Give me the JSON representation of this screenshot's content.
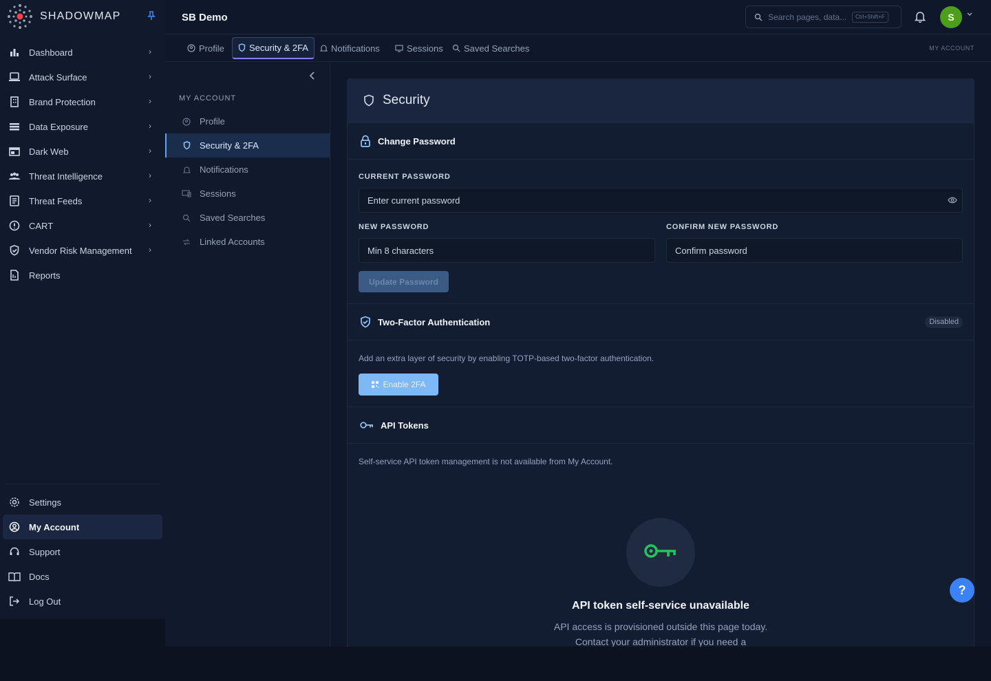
{
  "brand": {
    "name": "SHADOWMAP",
    "accent": "#3b82f6"
  },
  "header": {
    "org": "SB Demo",
    "search_placeholder": "Search pages, data...",
    "search_shortcut": "Ctrl+Shift+F",
    "avatar_initial": "S",
    "avatar_color": "#4d9e1a"
  },
  "sidebar": {
    "items": [
      {
        "label": "Dashboard",
        "icon": "bar-chart-icon"
      },
      {
        "label": "Attack Surface",
        "icon": "laptop-icon"
      },
      {
        "label": "Brand Protection",
        "icon": "building-icon"
      },
      {
        "label": "Data Exposure",
        "icon": "database-icon"
      },
      {
        "label": "Dark Web",
        "icon": "browser-icon"
      },
      {
        "label": "Threat Intelligence",
        "icon": "users-icon"
      },
      {
        "label": "Threat Feeds",
        "icon": "feed-icon"
      },
      {
        "label": "CART",
        "icon": "alert-circle-icon"
      },
      {
        "label": "Vendor Risk Management",
        "icon": "shield-check-icon"
      },
      {
        "label": "Reports",
        "icon": "report-icon"
      }
    ],
    "bottom": [
      {
        "label": "Settings",
        "icon": "gear-icon"
      },
      {
        "label": "My Account",
        "icon": "user-circle-icon"
      },
      {
        "label": "Support",
        "icon": "headset-icon"
      },
      {
        "label": "Docs",
        "icon": "book-icon"
      },
      {
        "label": "Log Out",
        "icon": "logout-icon"
      }
    ]
  },
  "tabs": {
    "items": [
      "Profile",
      "Security & 2FA",
      "Notifications",
      "Sessions",
      "Saved Searches"
    ],
    "active": "Security & 2FA",
    "right_label": "MY ACCOUNT"
  },
  "subnav": {
    "title": "MY ACCOUNT",
    "items": [
      "Profile",
      "Security & 2FA",
      "Notifications",
      "Sessions",
      "Saved Searches",
      "Linked Accounts"
    ]
  },
  "security": {
    "title": "Security",
    "change_password": {
      "title": "Change Password",
      "current_label": "CURRENT PASSWORD",
      "current_placeholder": "Enter current password",
      "new_label": "NEW PASSWORD",
      "new_placeholder": "Min 8 characters",
      "confirm_label": "CONFIRM NEW PASSWORD",
      "confirm_placeholder": "Confirm password",
      "button": "Update Password"
    },
    "two_factor": {
      "title": "Two-Factor Authentication",
      "status": "Disabled",
      "description": "Add an extra layer of security by enabling TOTP-based two-factor authentication.",
      "button": "Enable 2FA"
    },
    "api_tokens": {
      "title": "API Tokens",
      "description": "Self-service API token management is not available from My Account.",
      "empty_title": "API token self-service unavailable",
      "empty_text": "API access is provisioned outside this page today. Contact your administrator if you need a"
    }
  },
  "help": {
    "label": "?"
  }
}
